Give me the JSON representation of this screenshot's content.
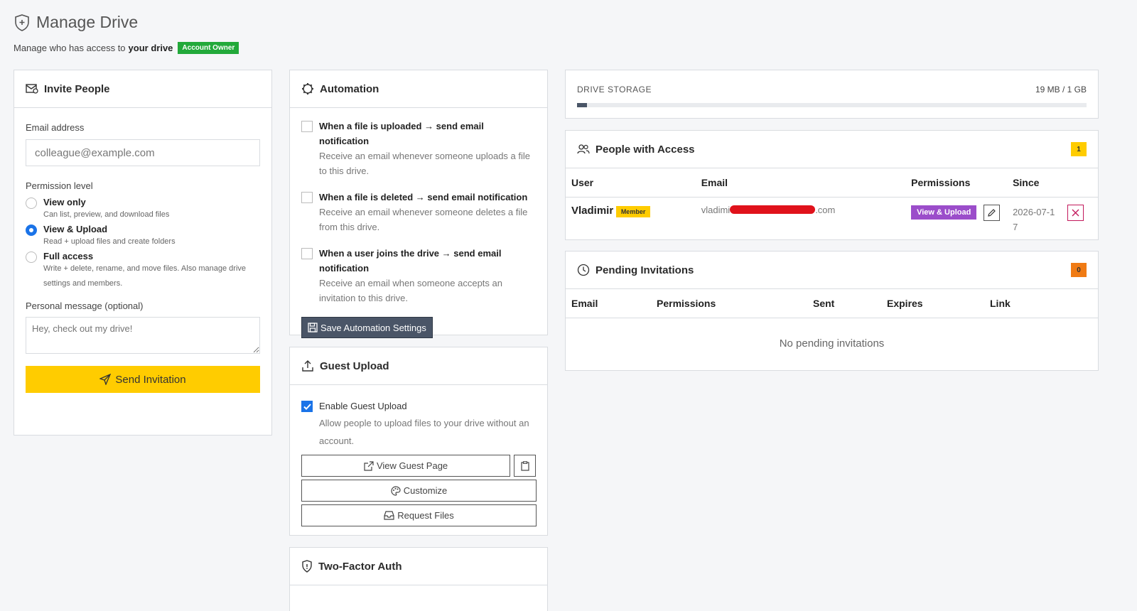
{
  "header": {
    "title": "Manage Drive",
    "subtitle_prefix": "Manage who has access to",
    "subtitle_bold": "your drive",
    "owner_badge": "Account Owner"
  },
  "invite": {
    "title": "Invite People",
    "email_label": "Email address",
    "email_placeholder": "colleague@example.com",
    "permission_label": "Permission level",
    "options": [
      {
        "title": "View only",
        "desc": "Can list, preview, and download files",
        "selected": false
      },
      {
        "title": "View & Upload",
        "desc": "Read + upload files and create folders",
        "selected": true
      },
      {
        "title": "Full access",
        "desc": "Write + delete, rename, and move files. Also manage drive settings and members.",
        "selected": false
      }
    ],
    "message_label": "Personal message (optional)",
    "message_placeholder": "Hey, check out my drive!",
    "send_label": "Send Invitation"
  },
  "automation": {
    "title": "Automation",
    "items": [
      {
        "title": "When a file is uploaded → send email notification",
        "desc": "Receive an email whenever someone uploads a file to this drive."
      },
      {
        "title": "When a file is deleted → send email notification",
        "desc": "Receive an email whenever someone deletes a file from this drive."
      },
      {
        "title": "When a user joins the drive → send email notification",
        "desc": "Receive an email when someone accepts an invitation to this drive."
      }
    ],
    "save_label": "Save Automation Settings"
  },
  "guest": {
    "title": "Guest Upload",
    "enable_label": "Enable Guest Upload",
    "enable_desc": "Allow people to upload files to your drive without an account.",
    "view_page_label": "View Guest Page",
    "customize_label": "Customize",
    "request_label": "Request Files"
  },
  "twofa": {
    "title": "Two-Factor Auth"
  },
  "storage": {
    "label": "DRIVE STORAGE",
    "value": "19 MB / 1 GB",
    "used_fraction": 0.019
  },
  "people": {
    "title": "People with Access",
    "count": "1",
    "columns": [
      "User",
      "Email",
      "Permissions",
      "Since"
    ],
    "rows": [
      {
        "user": "Vladimir",
        "role": "Member",
        "email_start": "vladimi",
        "email_end": ".com",
        "permission": "View & Upload",
        "since": "2026-07-17"
      }
    ]
  },
  "pending": {
    "title": "Pending Invitations",
    "count": "0",
    "columns": [
      "Email",
      "Permissions",
      "Sent",
      "Expires",
      "Link"
    ],
    "empty": "No pending invitations"
  },
  "colors": {
    "accent_yellow": "#ffcc00",
    "owner_green": "#22a93a",
    "permission_purple": "#9b4dca",
    "pending_orange": "#f07b14",
    "redaction_red": "#e0121b"
  }
}
